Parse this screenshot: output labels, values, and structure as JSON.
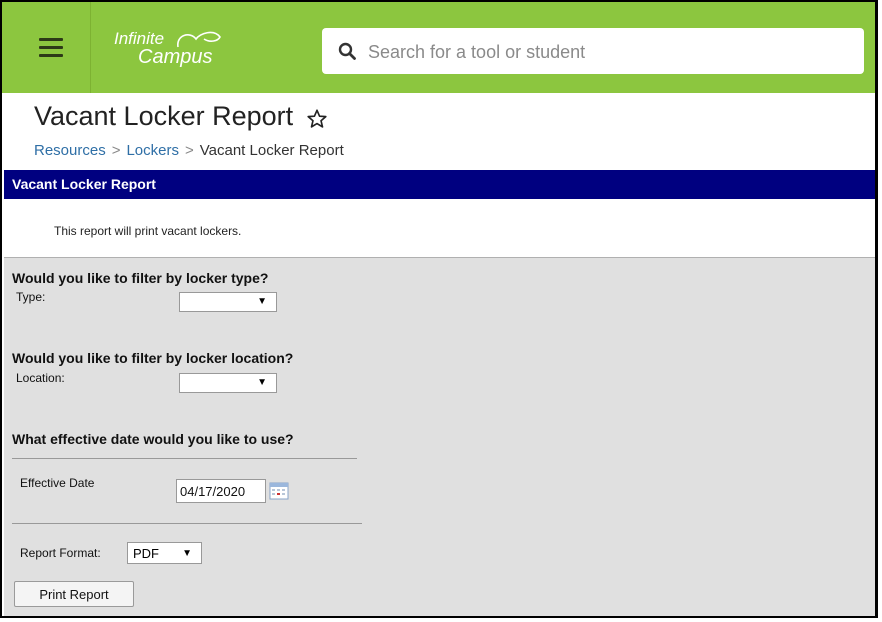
{
  "topbar": {
    "logo_line1": "Infinite",
    "logo_line2": "Campus",
    "search_placeholder": "Search for a tool or student",
    "accent": "#8cc63f"
  },
  "header": {
    "title": "Vacant Locker Report",
    "breadcrumb": [
      "Resources",
      "Lockers",
      "Vacant Locker Report"
    ]
  },
  "section": {
    "title": "Vacant Locker Report",
    "bar_color": "#000080",
    "description": "This report will print vacant lockers."
  },
  "form": {
    "q_type": "Would you like to filter by locker type?",
    "type_label": "Type:",
    "type_value": "",
    "q_location": "Would you like to filter by locker location?",
    "location_label": "Location:",
    "location_value": "",
    "q_date": "What effective date would you like to use?",
    "date_label": "Effective Date",
    "date_value": "04/17/2020",
    "format_label": "Report Format:",
    "format_value": "PDF",
    "print_button": "Print Report"
  }
}
